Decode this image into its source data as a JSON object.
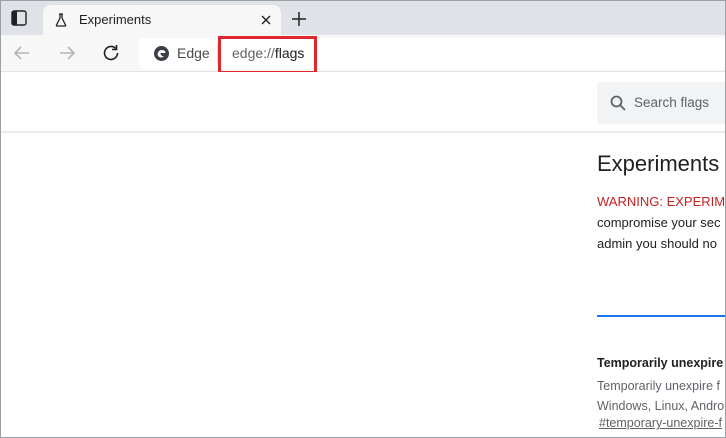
{
  "browser": {
    "tab": {
      "title": "Experiments"
    },
    "address_bar": {
      "brand_label": "Edge",
      "url_scheme": "edge://",
      "url_path": "flags"
    }
  },
  "flags_page": {
    "search": {
      "placeholder": "Search flags"
    },
    "title": "Experiments",
    "warning_prefix": "WARNING: EXPERIM",
    "warning_line2": "compromise your sec",
    "warning_line3": "admin you should no",
    "experiment": {
      "title": "Temporarily unexpire M",
      "desc_line1": "Temporarily unexpire f",
      "desc_line2": "Windows, Linux, Andro",
      "link": "#temporary-unexpire-f"
    }
  },
  "colors": {
    "highlight": "#e0262e",
    "warning": "#c5221f",
    "accent": "#1a73e8"
  },
  "icons": {
    "tab_actions": "tab-actions-icon",
    "favicon": "flask-icon",
    "close": "close-icon",
    "new_tab": "plus-icon",
    "back": "arrow-left-icon",
    "forward": "arrow-right-icon",
    "refresh": "refresh-icon",
    "edge": "edge-logo-icon",
    "search": "search-icon"
  }
}
